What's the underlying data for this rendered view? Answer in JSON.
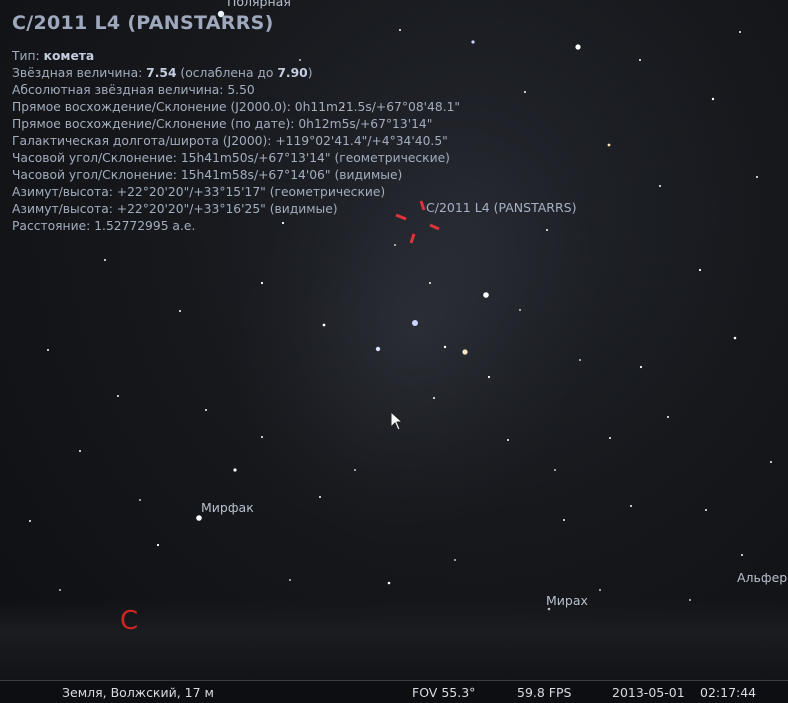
{
  "object": {
    "title": "C/2011 L4 (PANSTARRS)",
    "lines": [
      {
        "pre": "Тип: ",
        "bold": "комета",
        "post": ""
      },
      {
        "pre": "Звёздная величина: ",
        "bold": "7.54",
        "mid": " (ослаблена до ",
        "bold2": "7.90",
        "post": ")"
      },
      {
        "pre": "Абсолютная звёздная величина: 5.50"
      },
      {
        "pre": "Прямое восхождение/Склонение (J2000.0): 0h11m21.5s/+67°08'48.1\""
      },
      {
        "pre": "Прямое восхождение/Склонение (по дате): 0h12m5s/+67°13'14\""
      },
      {
        "pre": "Галактическая долгота/широта (J2000): +119°02'41.4\"/+4°34'40.5\""
      },
      {
        "pre": "Часовой угол/Склонение: 15h41m50s/+67°13'14\" (геометрические)"
      },
      {
        "pre": "Часовой угол/Склонение: 15h41m58s/+67°14'06\" (видимые)"
      },
      {
        "pre": "Азимут/высота: +22°20'20\"/+33°15'17\" (геометрические)"
      },
      {
        "pre": "Азимут/высота: +22°20'20\"/+33°16'25\" (видимые)"
      },
      {
        "pre": "Расстояние: 1.52772995 а.е."
      }
    ]
  },
  "sky_labels": {
    "polaris": "Полярная",
    "comet": "C/2011 L4 (PANSTARRS)",
    "mirfak": "Мирфак",
    "mirach": "Мирах",
    "alpheratz": "Альфер",
    "cardinal": "С"
  },
  "statusbar": {
    "location": "Земля, Волжский, 17 м",
    "fov": "FOV 55.3°",
    "fps": "59.8 FPS",
    "date": "2013-05-01",
    "time": "02:17:44"
  },
  "colors": {
    "marker": "#e0323a",
    "cardinal": "#d0261f"
  }
}
